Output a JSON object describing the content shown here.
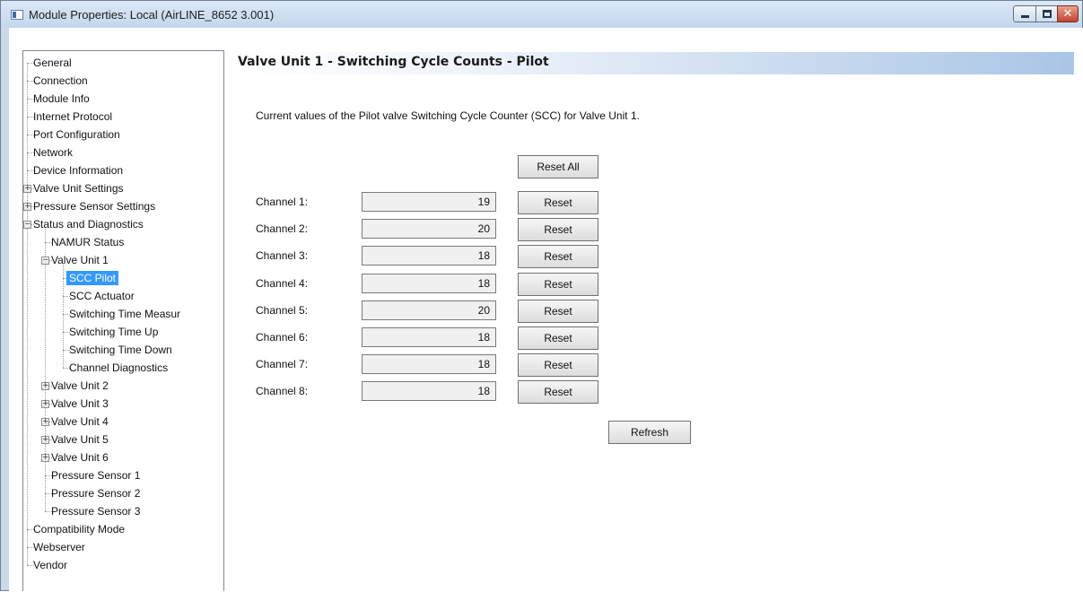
{
  "window": {
    "title": "Module Properties: Local (AirLINE_8652 3.001)"
  },
  "tree": [
    {
      "label": "General",
      "level": 0
    },
    {
      "label": "Connection",
      "level": 0
    },
    {
      "label": "Module Info",
      "level": 0
    },
    {
      "label": "Internet Protocol",
      "level": 0
    },
    {
      "label": "Port Configuration",
      "level": 0
    },
    {
      "label": "Network",
      "level": 0
    },
    {
      "label": "Device Information",
      "level": 0
    },
    {
      "label": "Valve Unit Settings",
      "level": 0,
      "expander": "+"
    },
    {
      "label": "Pressure Sensor Settings",
      "level": 0,
      "expander": "+"
    },
    {
      "label": "Status and Diagnostics",
      "level": 0,
      "expander": "-"
    },
    {
      "label": "NAMUR Status",
      "level": 1
    },
    {
      "label": "Valve Unit 1",
      "level": 1,
      "expander": "-"
    },
    {
      "label": "SCC Pilot",
      "level": 2,
      "selected": true
    },
    {
      "label": "SCC Actuator",
      "level": 2
    },
    {
      "label": "Switching Time Measur",
      "level": 2
    },
    {
      "label": "Switching Time Up",
      "level": 2
    },
    {
      "label": "Switching Time Down",
      "level": 2
    },
    {
      "label": "Channel Diagnostics",
      "level": 2
    },
    {
      "label": "Valve Unit 2",
      "level": 1,
      "expander": "+"
    },
    {
      "label": "Valve Unit 3",
      "level": 1,
      "expander": "+"
    },
    {
      "label": "Valve Unit 4",
      "level": 1,
      "expander": "+"
    },
    {
      "label": "Valve Unit 5",
      "level": 1,
      "expander": "+"
    },
    {
      "label": "Valve Unit 6",
      "level": 1,
      "expander": "+"
    },
    {
      "label": "Pressure Sensor 1",
      "level": 1
    },
    {
      "label": "Pressure Sensor 2",
      "level": 1
    },
    {
      "label": "Pressure Sensor 3",
      "level": 1
    },
    {
      "label": "Compatibility Mode",
      "level": 0
    },
    {
      "label": "Webserver",
      "level": 0
    },
    {
      "label": "Vendor",
      "level": 0
    }
  ],
  "panel": {
    "header": "Valve Unit 1 - Switching Cycle Counts - Pilot",
    "description": "Current values of the Pilot valve Switching Cycle Counter (SCC) for Valve Unit 1.",
    "reset_all_label": "Reset All",
    "reset_label": "Reset",
    "refresh_label": "Refresh",
    "channels": [
      {
        "label": "Channel 1:",
        "value": "19"
      },
      {
        "label": "Channel 2:",
        "value": "20"
      },
      {
        "label": "Channel 3:",
        "value": "18"
      },
      {
        "label": "Channel 4:",
        "value": "18"
      },
      {
        "label": "Channel 5:",
        "value": "20"
      },
      {
        "label": "Channel 6:",
        "value": "18"
      },
      {
        "label": "Channel 7:",
        "value": "18"
      },
      {
        "label": "Channel 8:",
        "value": "18"
      }
    ]
  },
  "colors": {
    "selection": "#3399ff",
    "title_bar": "#c9d9ea",
    "close_button": "#c4432c"
  },
  "icons": [
    "app-icon",
    "minimize-icon",
    "maximize-icon",
    "close-icon",
    "expand-icon",
    "collapse-icon"
  ]
}
